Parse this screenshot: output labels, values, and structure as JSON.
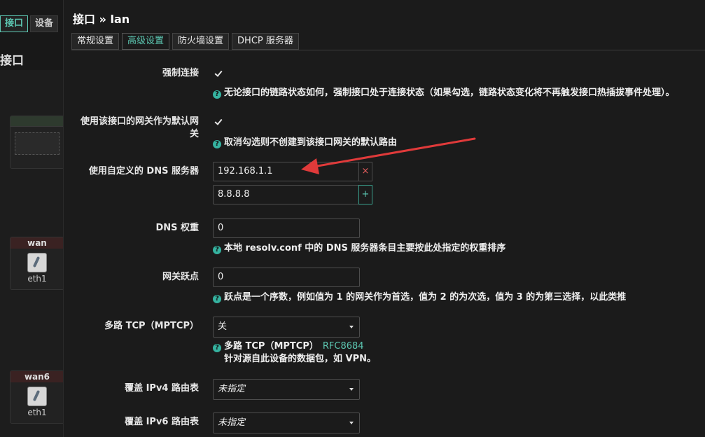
{
  "background": {
    "tabs": [
      {
        "label": "接口",
        "active": true
      },
      {
        "label": "设备",
        "active": false
      }
    ],
    "page_title": "接口",
    "cards": [
      {
        "name": "wan",
        "label": "eth1"
      },
      {
        "name": "wan6",
        "label": "eth1"
      }
    ]
  },
  "modal": {
    "title": "接口 » lan",
    "tabs": [
      {
        "label": "常规设置",
        "active": false
      },
      {
        "label": "高级设置",
        "active": true
      },
      {
        "label": "防火墙设置",
        "active": false
      },
      {
        "label": "DHCP 服务器",
        "active": false
      }
    ]
  },
  "form": {
    "force_link": {
      "label": "强制连接",
      "checked": true,
      "help": "无论接口的链路状态如何，强制接口处于连接状态（如果勾选，链路状态变化将不再触发接口热插拔事件处理）。"
    },
    "default_gateway": {
      "label_line1": "使用该接口的网关作为默认网",
      "label_line2": "关",
      "checked": true,
      "help": "取消勾选则不创建到该接口网关的默认路由"
    },
    "custom_dns": {
      "label": "使用自定义的 DNS 服务器",
      "values": [
        "192.168.1.1",
        "8.8.8.8"
      ],
      "remove_symbol": "×",
      "add_symbol": "+"
    },
    "dns_weight": {
      "label": "DNS 权重",
      "value": "0",
      "help": "本地 resolv.conf 中的 DNS 服务器条目主要按此处指定的权重排序"
    },
    "gateway_metric": {
      "label": "网关跃点",
      "value": "0",
      "help": "跃点是一个序数，例如值为 1 的网关作为首选，值为 2 的为次选，值为 3 的为第三选择，以此类推"
    },
    "mptcp": {
      "label": "多路 TCP（MPTCP）",
      "selected": "关",
      "help_line1": "多路 TCP（MPTCP）",
      "help_link": "RFC8684",
      "help_line2": "针对源自此设备的数据包，如 VPN。"
    },
    "ipv4_table": {
      "label": "覆盖 IPv4 路由表",
      "selected": "未指定"
    },
    "ipv6_table": {
      "label": "覆盖 IPv6 路由表",
      "selected": "未指定"
    }
  },
  "colors": {
    "accent": "#5cc7b2",
    "annotation_arrow": "#e03a3a",
    "remove": "#e05b5b"
  }
}
